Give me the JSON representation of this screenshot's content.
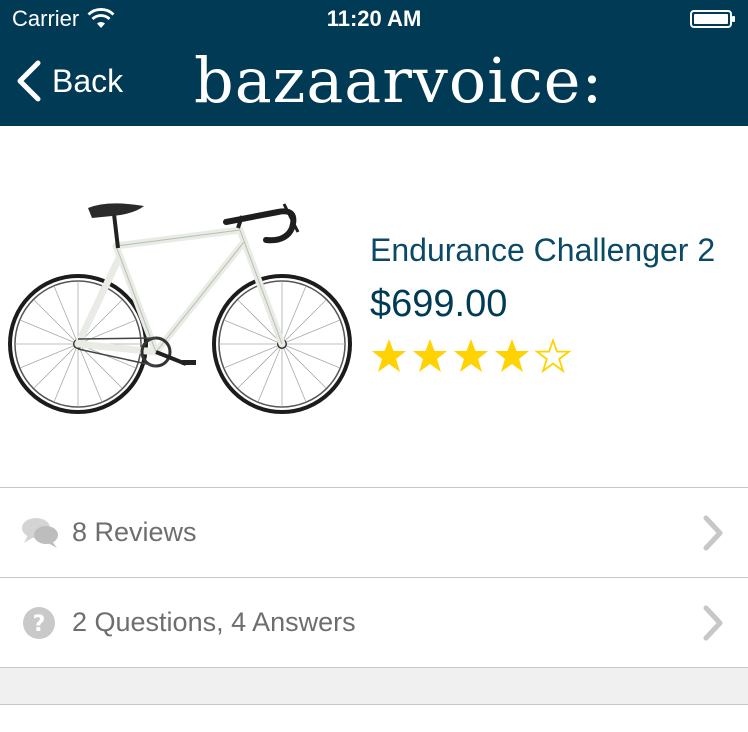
{
  "status_bar": {
    "carrier": "Carrier",
    "time": "11:20 AM"
  },
  "nav": {
    "back_label": "Back",
    "brand": "bazaarvoice:"
  },
  "product": {
    "name": "Endurance Challenger 2",
    "price": "$699.00",
    "rating": 4,
    "rating_max": 5
  },
  "rows": {
    "reviews_label": "8 Reviews",
    "questions_label": "2 Questions, 4 Answers"
  },
  "colors": {
    "header_bg": "#003a55",
    "star": "#ffd200",
    "name_text": "#0b4a66",
    "row_text": "#6e6e6e"
  },
  "icons": {
    "reviews": "chat-bubbles-icon",
    "questions": "question-circle-icon",
    "chevron": "chevron-right-icon"
  }
}
